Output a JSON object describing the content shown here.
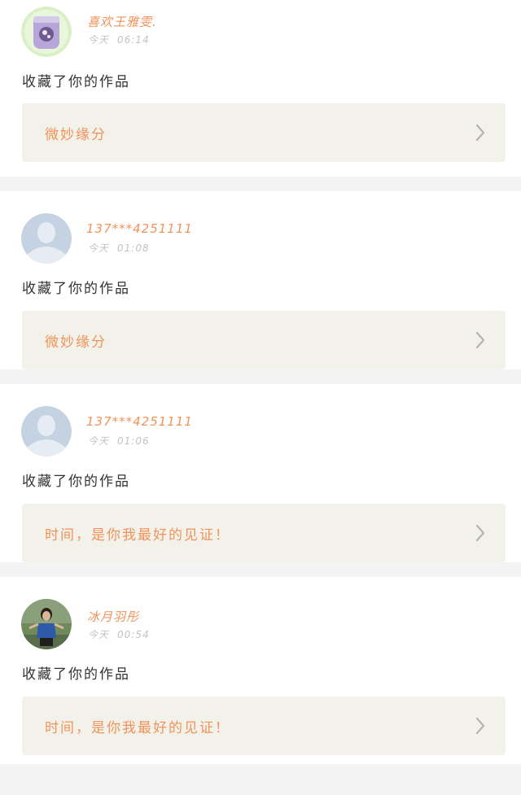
{
  "notifications": [
    {
      "username": "喜欢王雅雯.",
      "day": "今天",
      "time": "06:14",
      "action": "收藏了你的作品",
      "work_title": "微妙缘分",
      "avatar_icon": "photo-avatar-icon"
    },
    {
      "username": "137***4251111",
      "day": "今天",
      "time": "01:08",
      "action": "收藏了你的作品",
      "work_title": "微妙缘分",
      "avatar_icon": "default-user-avatar-icon"
    },
    {
      "username": "137***4251111",
      "day": "今天",
      "time": "01:06",
      "action": "收藏了你的作品",
      "work_title": "时间，是你我最好的见证！",
      "avatar_icon": "default-user-avatar-icon"
    },
    {
      "username": "冰月羽彤",
      "day": "今天",
      "time": "00:54",
      "action": "收藏了你的作品",
      "work_title": "时间，是你我最好的见证！",
      "avatar_icon": "photo-avatar-icon"
    }
  ],
  "colors": {
    "accent": "#f0935a",
    "card_bg": "#ffffff",
    "work_bg": "#f3f2ea",
    "gap_bg": "#f4f4f4",
    "muted_text": "#c2c2c2",
    "body_text": "#333333"
  }
}
